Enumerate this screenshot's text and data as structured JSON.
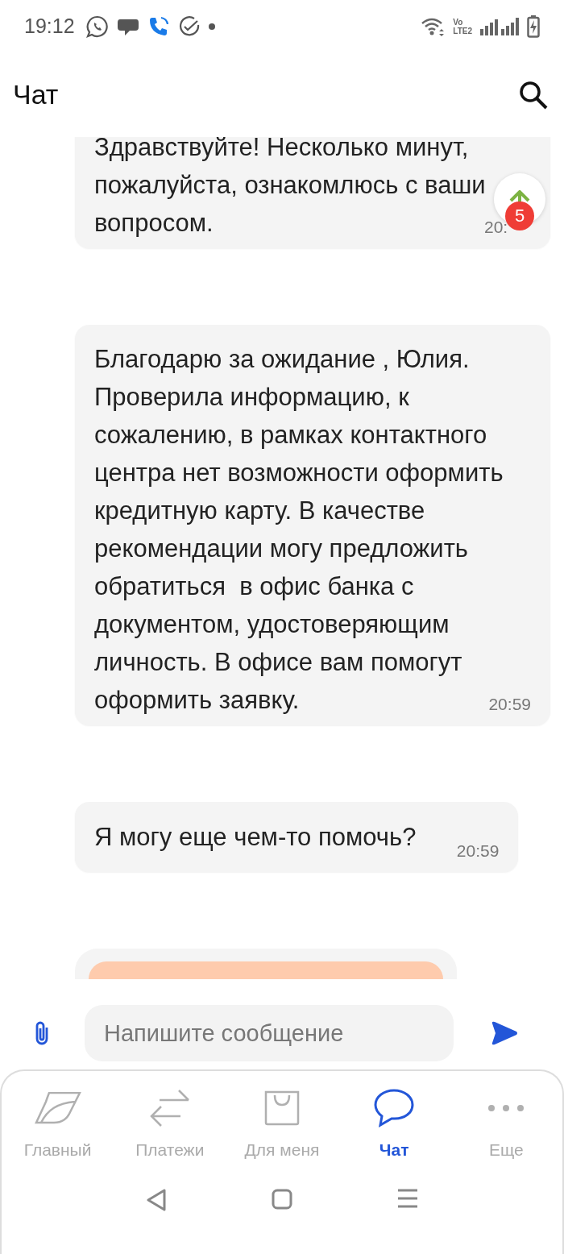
{
  "status_bar": {
    "time": "19:12",
    "volte_top": "Vo",
    "volte_bottom": "LTE2"
  },
  "header": {
    "title": "Чат"
  },
  "messages": [
    {
      "kind": "lines",
      "lines": [
        "Здравствуйте! Несколько минут,",
        "пожалуйста, ознакомлюсь с ваши",
        "вопросом."
      ],
      "time": "20:"
    },
    {
      "kind": "lines",
      "lines": [
        "Благодарю за ожидание , Юлия.",
        "Проверила информацию, к",
        "сожалению, в рамках контактного",
        "центра нет возможности оформить",
        "кредитную карту. В качестве",
        "рекомендации могу предложить",
        "обратиться  в офис банка с",
        "документом, удостоверяющим",
        "личность. В офисе вам помогут",
        "оформить заявку."
      ],
      "time": "20:59"
    },
    {
      "kind": "inline",
      "text": "Я могу еще чем-то помочь?",
      "time": "20:59"
    },
    {
      "kind": "card"
    }
  ],
  "scroll_button": {
    "badge": "5"
  },
  "composer": {
    "placeholder": "Напишите сообщение"
  },
  "nav": [
    {
      "kind": "home",
      "label": "Главный",
      "selected": false
    },
    {
      "kind": "payments",
      "label": "Платежи",
      "selected": false
    },
    {
      "kind": "bag",
      "label": "Для меня",
      "selected": false
    },
    {
      "kind": "chat",
      "label": "Чат",
      "selected": true
    },
    {
      "kind": "more",
      "label": "Еще",
      "selected": false
    }
  ]
}
